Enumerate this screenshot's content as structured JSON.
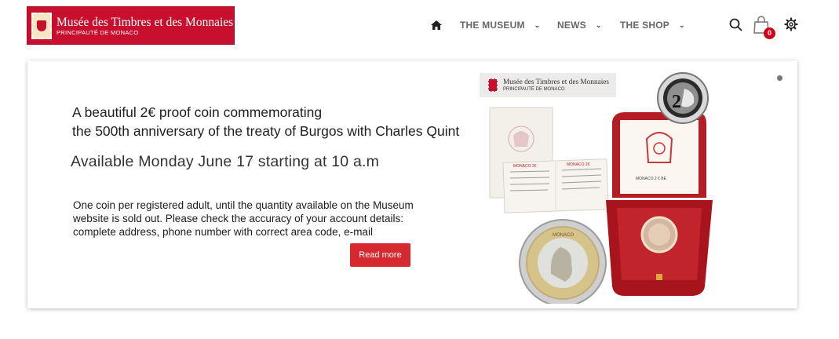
{
  "header": {
    "logo": {
      "title": "Musée des Timbres et des Monnaies",
      "subtitle": "PRINCIPAUTÉ DE MONACO"
    },
    "nav": [
      {
        "label": "THE MUSEUM",
        "icon": "chevron-down-icon"
      },
      {
        "label": "NEWS",
        "icon": "chevron-down-icon"
      },
      {
        "label": "THE SHOP",
        "icon": "chevron-down-icon"
      }
    ],
    "cart_count": "0",
    "icons": [
      "home-icon",
      "search-icon",
      "shopping-bag-icon",
      "gear-icon"
    ]
  },
  "banner": {
    "headline_line1": "A beautiful 2€ proof coin commemorating",
    "headline_line2": "the 500th anniversary of the treaty of Burgos with Charles Quint",
    "availability": "Available Monday June 17 starting at 10 a.m",
    "note": "One coin per registered adult, until the quantity available on the Museum website is sold out. Please check the accuracy of your account details: complete address, phone number with correct area code, e-mail",
    "button_label": "Read more",
    "image": {
      "logo_title": "Musée des Timbres et des Monnaies",
      "logo_subtitle": "PRINCIPAUTÉ DE MONACO",
      "coin_face_value": "2"
    }
  },
  "colors": {
    "brand_red": "#c8102e",
    "button_red": "#d7282f",
    "nav_text": "#666666",
    "badge_red": "#d0021b"
  }
}
